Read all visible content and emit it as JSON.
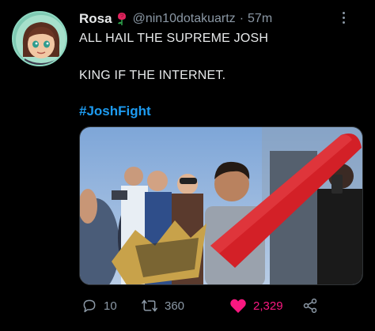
{
  "tweet": {
    "display_name": "Rosa",
    "handle": "@nin10dotakuartz",
    "separator": "·",
    "timestamp": "57m",
    "text_line1": "ALL HAIL THE SUPREME JOSH",
    "text_line2": "KING IF THE INTERNET.",
    "hashtag": "#JoshFight"
  },
  "actions": {
    "replies": "10",
    "retweets": "360",
    "likes": "2,329"
  },
  "colors": {
    "background": "#000000",
    "text": "#e7e9ea",
    "secondary": "#8b98a5",
    "link": "#1d9bf0",
    "like": "#f91880"
  },
  "icons": {
    "reply": "reply-bubble-icon",
    "retweet": "retweet-arrows-icon",
    "like": "heart-filled-icon",
    "share": "share-nodes-icon",
    "more": "more-vertical-icon",
    "emoji": "rose-emoji-icon"
  }
}
